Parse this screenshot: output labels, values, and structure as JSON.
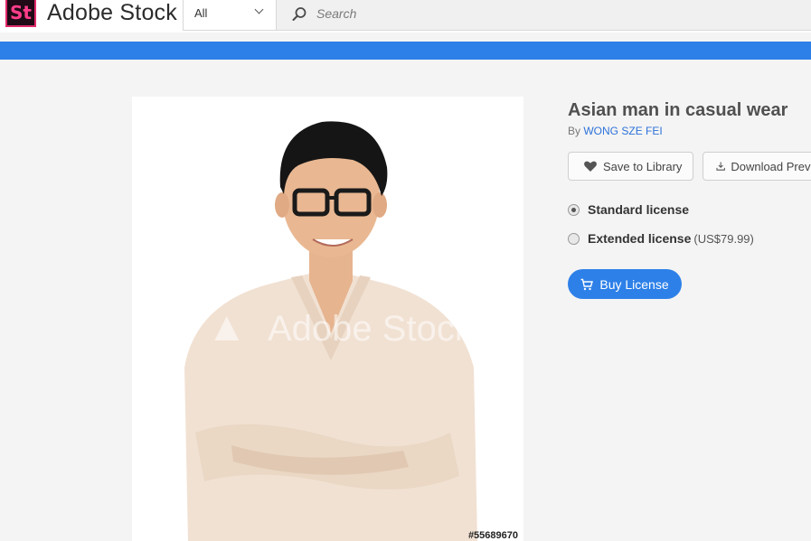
{
  "header": {
    "logo_text": "St",
    "brand": "Adobe Stock",
    "filter_value": "All",
    "search_placeholder": "Search"
  },
  "asset": {
    "watermark": "Adobe Stock",
    "asset_id": "#55689670",
    "title": "Asian man in casual wear",
    "by_label": "By",
    "author": "WONG SZE FEI"
  },
  "actions": {
    "save_label": "Save to Library",
    "download_label": "Download Preview"
  },
  "licenses": [
    {
      "name": "Standard license",
      "price": "",
      "selected": true
    },
    {
      "name": "Extended license",
      "price": "(US$79.99)",
      "selected": false
    }
  ],
  "buy_label": "Buy License",
  "colors": {
    "accent": "#2d80e8",
    "logo_bg": "#1f0a16",
    "logo_pink": "#ff3d8a",
    "link": "#2d72d9"
  },
  "icons": {
    "search": "search-icon",
    "heart": "heart-icon",
    "download": "download-icon",
    "cart": "cart-icon",
    "chevron": "chevron-down-icon"
  }
}
